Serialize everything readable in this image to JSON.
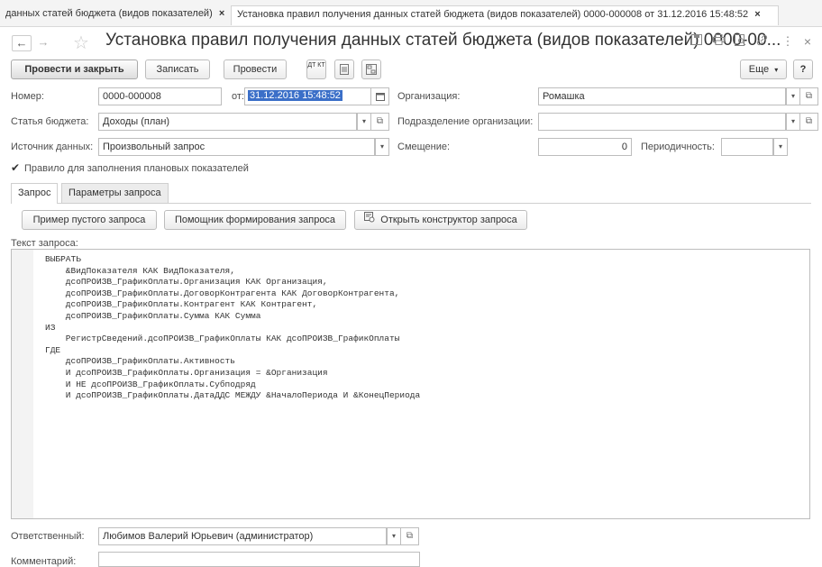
{
  "tabs": {
    "tab1_label": "данных статей бюджета (видов показателей)",
    "tab2_label": "Установка правил получения данных статей бюджета (видов показателей) 0000-000008 от 31.12.2016 15:48:52",
    "close_glyph": "×"
  },
  "header": {
    "back_glyph": "←",
    "forward_glyph": "→",
    "star_glyph": "☆",
    "title": "Установка правил получения данных статей бюджета (видов показателей) 0000-00...",
    "icons": [
      "save-icon",
      "print-icon",
      "preview-icon",
      "link-icon",
      "more-icon",
      "close-icon"
    ],
    "more_glyph": "⋮",
    "close_glyph": "×"
  },
  "toolbar": {
    "post_close": "Провести и закрыть",
    "save": "Записать",
    "post": "Провести",
    "dtkt_label": "ДТ КТ",
    "more": "Еще",
    "help": "?"
  },
  "form": {
    "number_label": "Номер:",
    "number_value": "0000-000008",
    "date_label": "от:",
    "date_value": "31.12.2016 15:48:52",
    "org_label": "Организация:",
    "org_value": "Ромашка",
    "budget_label": "Статья бюджета:",
    "budget_value": "Доходы (план)",
    "dept_label": "Подразделение организации:",
    "dept_value": "",
    "source_label": "Источник данных:",
    "source_value": "Произвольный запрос",
    "offset_label": "Смещение:",
    "offset_value": "0",
    "period_label": "Периодичность:",
    "period_value": "",
    "rule_checkbox_label": "Правило для заполнения плановых показателей",
    "rule_checked": true
  },
  "inner_tabs": {
    "query": "Запрос",
    "params": "Параметры запроса"
  },
  "query_buttons": {
    "empty_example": "Пример пустого запроса",
    "helper": "Помощник формирования запроса",
    "constructor": "Открыть конструктор запроса"
  },
  "query_text_label": "Текст запроса:",
  "query_text": "ВЫБРАТЬ\n    &ВидПоказателя КАК ВидПоказателя,\n    дсоПРОИЗВ_ГрафикОплаты.Организация КАК Организация,\n    дсоПРОИЗВ_ГрафикОплаты.ДоговорКонтрагента КАК ДоговорКонтрагента,\n    дсоПРОИЗВ_ГрафикОплаты.Контрагент КАК Контрагент,\n    дсоПРОИЗВ_ГрафикОплаты.Сумма КАК Сумма\nИЗ\n    РегистрСведений.дсоПРОИЗВ_ГрафикОплаты КАК дсоПРОИЗВ_ГрафикОплаты\nГДЕ\n    дсоПРОИЗВ_ГрафикОплаты.Активность\n    И дсоПРОИЗВ_ГрафикОплаты.Организация = &Организация\n    И НЕ дсоПРОИЗВ_ГрафикОплаты.Субподряд\n    И дсоПРОИЗВ_ГрафикОплаты.ДатаДДС МЕЖДУ &НачалоПериода И &КонецПериода",
  "footer": {
    "responsible_label": "Ответственный:",
    "responsible_value": "Любимов Валерий Юрьевич (администратор)",
    "comment_label": "Комментарий:",
    "comment_value": ""
  }
}
